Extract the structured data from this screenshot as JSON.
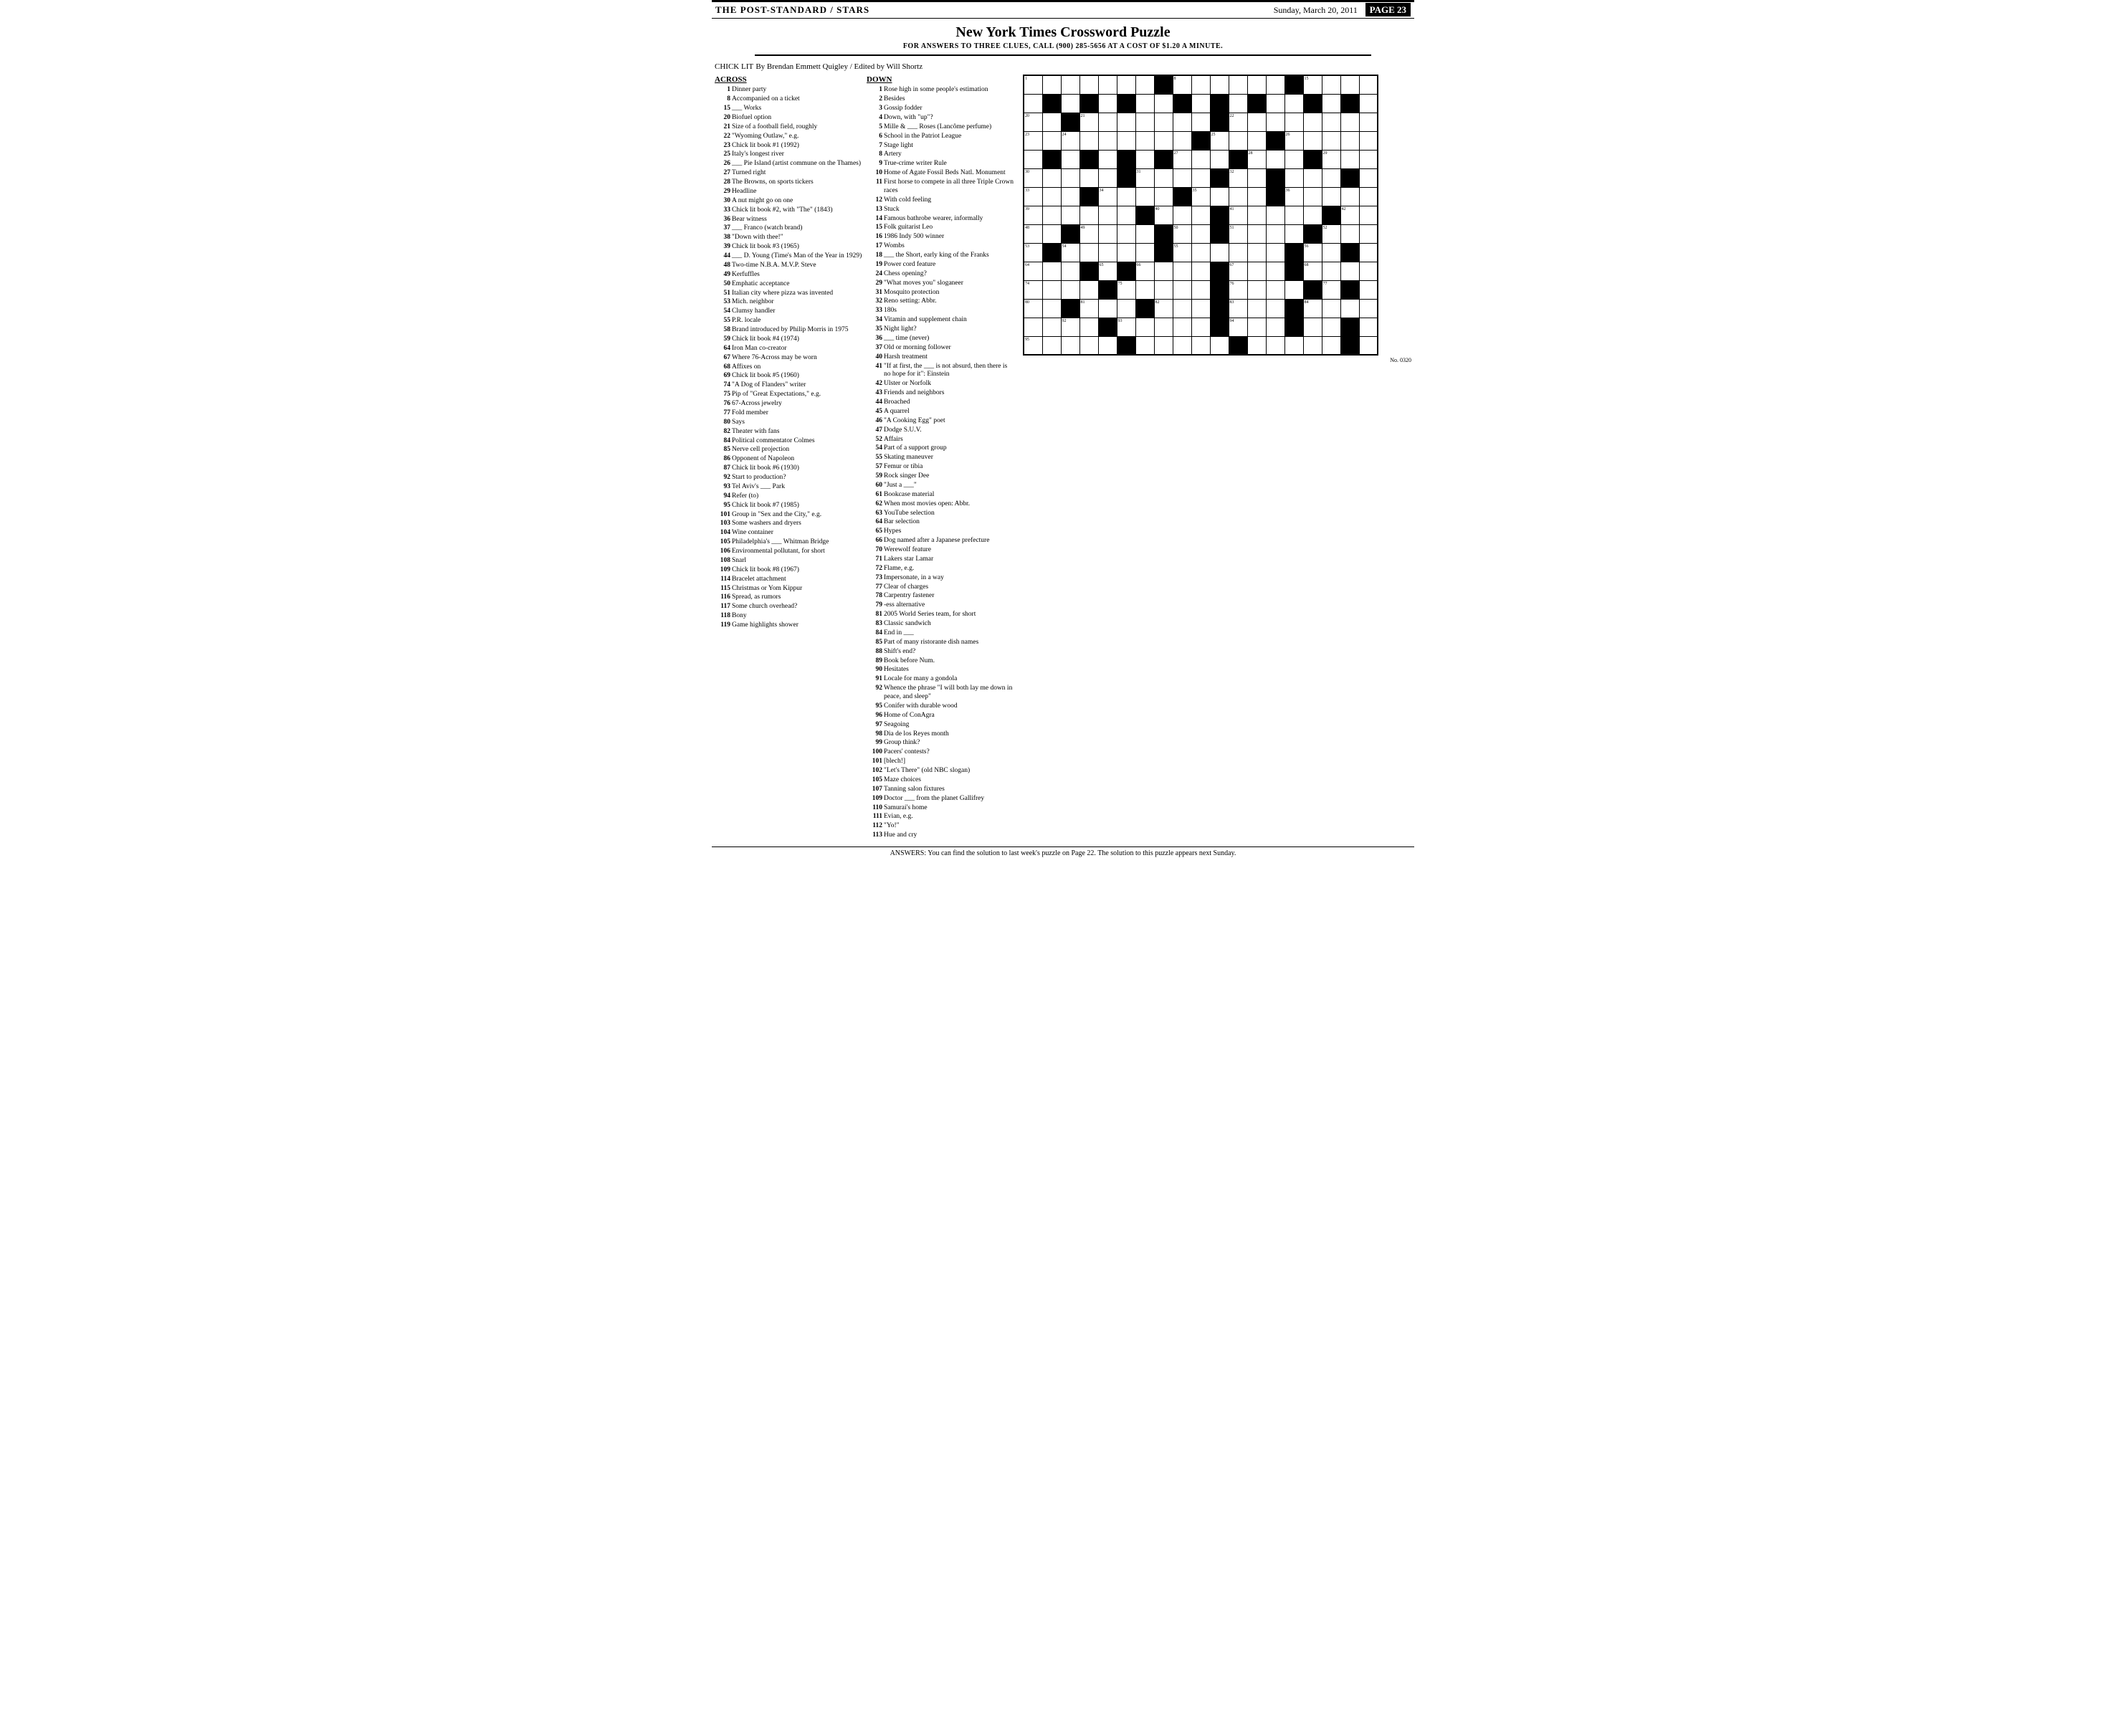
{
  "header": {
    "left": "THE POST-STANDARD / STARS",
    "right": "Sunday, March 20, 2011",
    "page": "PAGE 23"
  },
  "puzzle": {
    "title": "New York Times Crossword Puzzle",
    "subtitle": "FOR ANSWERS TO THREE CLUES, CALL (900) 285-5656 AT A COST OF $1.20 A MINUTE.",
    "byline": "CHICK LIT",
    "byline_credit": "By Brendan Emmett Quigley / Edited by Will Shortz"
  },
  "across_clues": [
    {
      "num": "1",
      "text": "Dinner party"
    },
    {
      "num": "8",
      "text": "Accompanied on a ticket"
    },
    {
      "num": "15",
      "text": "___ Works"
    },
    {
      "num": "20",
      "text": "Biofuel option"
    },
    {
      "num": "21",
      "text": "Size of a football field, roughly"
    },
    {
      "num": "22",
      "text": "\"Wyoming Outlaw,\" e.g."
    },
    {
      "num": "23",
      "text": "Chick lit book #1 (1992)"
    },
    {
      "num": "25",
      "text": "Italy's longest river"
    },
    {
      "num": "26",
      "text": "___ Pie Island (artist commune on the Thames)"
    },
    {
      "num": "27",
      "text": "Turned right"
    },
    {
      "num": "28",
      "text": "The Browns, on sports tickers"
    },
    {
      "num": "29",
      "text": "Headline"
    },
    {
      "num": "30",
      "text": "A nut might go on one"
    },
    {
      "num": "33",
      "text": "Chick lit book #2, with \"The\" (1843)"
    },
    {
      "num": "36",
      "text": "Bear witness"
    },
    {
      "num": "37",
      "text": "___ Franco (watch brand)"
    },
    {
      "num": "38",
      "text": "\"Down with thee!\""
    },
    {
      "num": "39",
      "text": "Chick lit book #3 (1965)"
    },
    {
      "num": "44",
      "text": "___ D. Young (Time's Man of the Year in 1929)"
    },
    {
      "num": "48",
      "text": "Two-time N.B.A. M.V.P. Steve"
    },
    {
      "num": "49",
      "text": "Kerfuffles"
    },
    {
      "num": "50",
      "text": "Emphatic acceptance"
    },
    {
      "num": "51",
      "text": "Italian city where pizza was invented"
    },
    {
      "num": "53",
      "text": "Mich. neighbor"
    },
    {
      "num": "54",
      "text": "Clumsy handler"
    },
    {
      "num": "55",
      "text": "P.R. locale"
    },
    {
      "num": "58",
      "text": "Brand introduced by Philip Morris in 1975"
    },
    {
      "num": "59",
      "text": "Chick lit book #4 (1974)"
    },
    {
      "num": "64",
      "text": "Iron Man co-creator"
    },
    {
      "num": "67",
      "text": "Where 76-Across may be worn"
    },
    {
      "num": "68",
      "text": "Affixes on"
    },
    {
      "num": "69",
      "text": "Chick lit book #5 (1960)"
    },
    {
      "num": "74",
      "text": "\"A Dog of Flanders\" writer"
    },
    {
      "num": "75",
      "text": "Pip of \"Great Expectations,\" e.g."
    },
    {
      "num": "76",
      "text": "67-Across jewelry"
    },
    {
      "num": "77",
      "text": "Fold member"
    },
    {
      "num": "80",
      "text": "Says"
    },
    {
      "num": "82",
      "text": "Theater with fans"
    },
    {
      "num": "84",
      "text": "Political commentator Colmes"
    },
    {
      "num": "85",
      "text": "Nerve cell projection"
    },
    {
      "num": "86",
      "text": "Opponent of Napoleon"
    },
    {
      "num": "87",
      "text": "Chick lit book #6 (1930)"
    },
    {
      "num": "92",
      "text": "Start to production?"
    },
    {
      "num": "93",
      "text": "Tel Aviv's ___ Park"
    },
    {
      "num": "94",
      "text": "Refer (to)"
    },
    {
      "num": "95",
      "text": "Chick lit book #7 (1985)"
    },
    {
      "num": "101",
      "text": "Group in \"Sex and the City,\" e.g."
    },
    {
      "num": "103",
      "text": "Some washers and dryers"
    },
    {
      "num": "104",
      "text": "Wine container"
    },
    {
      "num": "105",
      "text": "Philadelphia's ___ Whitman Bridge"
    },
    {
      "num": "106",
      "text": "Environmental pollutant, for short"
    },
    {
      "num": "108",
      "text": "Snarl"
    },
    {
      "num": "109",
      "text": "Chick lit book #8 (1967)"
    },
    {
      "num": "114",
      "text": "Bracelet attachment"
    },
    {
      "num": "115",
      "text": "Christmas or Yom Kippur"
    },
    {
      "num": "116",
      "text": "Spread, as rumors"
    },
    {
      "num": "117",
      "text": "Some church overhead?"
    },
    {
      "num": "118",
      "text": "Bony"
    },
    {
      "num": "119",
      "text": "Game highlights shower"
    },
    {
      "num": "31",
      "text": "Mosquito protection"
    },
    {
      "num": "32",
      "text": "Reno setting: Abbr."
    },
    {
      "num": "33",
      "text": "180s"
    },
    {
      "num": "34",
      "text": "Vitamin and supplement chain"
    },
    {
      "num": "35",
      "text": "Night light?"
    },
    {
      "num": "36",
      "text": "___ time (never)"
    },
    {
      "num": "37",
      "text": "Old or morning follower"
    },
    {
      "num": "40",
      "text": "Harsh treatment"
    },
    {
      "num": "41",
      "text": "\"If at first, the ___ is not absurd, then there is no hope for it\": Einstein"
    },
    {
      "num": "42",
      "text": "Ulster or Norfolk"
    },
    {
      "num": "43",
      "text": "Friends and neighbors"
    },
    {
      "num": "44",
      "text": "Broached"
    },
    {
      "num": "45",
      "text": "A quarrel"
    },
    {
      "num": "46",
      "text": "\"A Cooking Egg\" poet"
    },
    {
      "num": "47",
      "text": "Dodge S.U.V."
    },
    {
      "num": "52",
      "text": "Affairs"
    },
    {
      "num": "54",
      "text": "Part of a support group"
    },
    {
      "num": "55",
      "text": "Skating maneuver"
    },
    {
      "num": "57",
      "text": "Femur or tibia"
    },
    {
      "num": "59",
      "text": "Rock singer Dee"
    },
    {
      "num": "60",
      "text": "\"Just a ___\""
    },
    {
      "num": "61",
      "text": "Bookcase material"
    },
    {
      "num": "62",
      "text": "When most movies open: Abbr."
    },
    {
      "num": "63",
      "text": "YouTube selection"
    },
    {
      "num": "64",
      "text": "Bar selection"
    },
    {
      "num": "65",
      "text": "Hypes"
    },
    {
      "num": "66",
      "text": "Dog named after a Japanese prefecture"
    },
    {
      "num": "70",
      "text": "Werewolf feature"
    },
    {
      "num": "71",
      "text": "Lakers star Lamar"
    },
    {
      "num": "72",
      "text": "Flame, e.g."
    },
    {
      "num": "73",
      "text": "Impersonate, in a way"
    },
    {
      "num": "77",
      "text": "Clear of charges"
    }
  ],
  "down_clues": [
    {
      "num": "1",
      "text": "Rose high in some people's estimation"
    },
    {
      "num": "2",
      "text": "Besides"
    },
    {
      "num": "3",
      "text": "Gossip fodder"
    },
    {
      "num": "4",
      "text": "Down, with \"up\"?"
    },
    {
      "num": "5",
      "text": "Mille & ___ Roses (Lancôme perfume)"
    },
    {
      "num": "6",
      "text": "School in the Patriot League"
    },
    {
      "num": "7",
      "text": "Stage light"
    },
    {
      "num": "8",
      "text": "Artery"
    },
    {
      "num": "9",
      "text": "True-crime writer Rule"
    },
    {
      "num": "10",
      "text": "Home of Agate Fossil Beds Natl. Monument"
    },
    {
      "num": "11",
      "text": "First horse to compete in all three Triple Crown races"
    },
    {
      "num": "12",
      "text": "With cold feeling"
    },
    {
      "num": "13",
      "text": "Stuck"
    },
    {
      "num": "14",
      "text": "Famous bathrobe wearer, informally"
    },
    {
      "num": "15",
      "text": "Folk guitarist Leo"
    },
    {
      "num": "16",
      "text": "1986 Indy 500 winner"
    },
    {
      "num": "17",
      "text": "Wombs"
    },
    {
      "num": "18",
      "text": "___ the Short, early king of the Franks"
    },
    {
      "num": "19",
      "text": "Power cord feature"
    },
    {
      "num": "24",
      "text": "Chess opening?"
    },
    {
      "num": "29",
      "text": "\"What moves you\" sloganeer"
    },
    {
      "num": "78",
      "text": "Carpentry fastener"
    },
    {
      "num": "79",
      "text": "-ess alternative"
    },
    {
      "num": "81",
      "text": "2005 World Series team, for short"
    },
    {
      "num": "83",
      "text": "Classic sandwich"
    },
    {
      "num": "84",
      "text": "End in ___"
    },
    {
      "num": "85",
      "text": "Part of many ristorante dish names"
    },
    {
      "num": "88",
      "text": "Shift's end?"
    },
    {
      "num": "89",
      "text": "Book before Num."
    },
    {
      "num": "90",
      "text": "Hesitates"
    },
    {
      "num": "91",
      "text": "Locale for many a gondola"
    },
    {
      "num": "92",
      "text": "Whence the phrase \"I will both lay me down in peace, and sleep\""
    },
    {
      "num": "95",
      "text": "Conifer with durable wood"
    },
    {
      "num": "96",
      "text": "Home of ConAgra"
    },
    {
      "num": "97",
      "text": "Seagoing"
    },
    {
      "num": "98",
      "text": "Dia de los Reyes month"
    },
    {
      "num": "99",
      "text": "Group think?"
    },
    {
      "num": "100",
      "text": "Pacers' contests?"
    },
    {
      "num": "101",
      "text": "[blech!]"
    },
    {
      "num": "102",
      "text": "\"Let's There\" (old NBC slogan)"
    },
    {
      "num": "105",
      "text": "Maze choices"
    },
    {
      "num": "107",
      "text": "Tanning salon fixtures"
    },
    {
      "num": "109",
      "text": "Doctor ___ from the planet Gallifrey"
    },
    {
      "num": "110",
      "text": "Samurai's home"
    },
    {
      "num": "111",
      "text": "Evian, e.g."
    },
    {
      "num": "112",
      "text": "\"Yo!\""
    },
    {
      "num": "113",
      "text": "Hue and cry"
    }
  ],
  "footer": {
    "answers_text": "ANSWERS: You can find the solution to last week's puzzle on Page 22. The solution to this puzzle appears next Sunday.",
    "no_num": "No. 0320"
  }
}
